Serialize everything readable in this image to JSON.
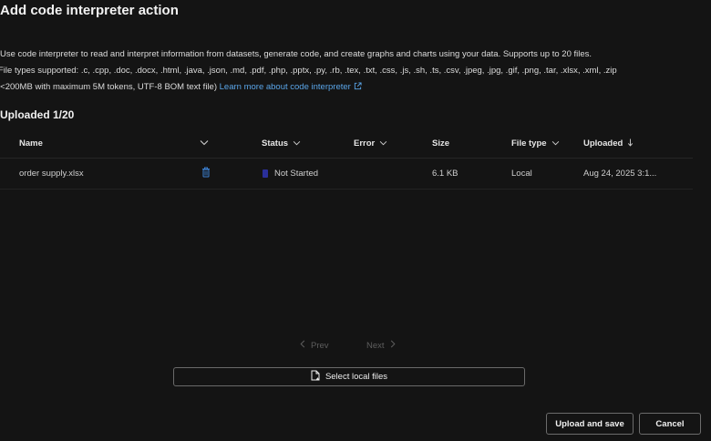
{
  "dialog": {
    "title": "Add code interpreter action",
    "description_line1": "Use code interpreter to read and interpret information from datasets, generate code, and create graphs and charts using your data. Supports up to 20 files.",
    "description_line2": "File types supported: .c, .cpp, .doc, .docx, .html, .java, .json, .md, .pdf, .php, .pptx, .py, .rb, .tex, .txt, .css, .js, .sh, .ts, .csv, .jpeg, .jpg, .gif, .png, .tar, .xlsx, .xml, .zip",
    "description_line3": "(<200MB with maximum 5M tokens, UTF-8 BOM text file)",
    "learn_more_link": "Learn more about code interpreter",
    "uploaded_label": "Uploaded 1/20"
  },
  "table": {
    "columns": {
      "name": "Name",
      "status": "Status",
      "error": "Error",
      "size": "Size",
      "file_type": "File type",
      "uploaded": "Uploaded"
    },
    "rows": [
      {
        "name": "order supply.xlsx",
        "status": "Not Started",
        "error": "",
        "size": "6.1 KB",
        "file_type": "Local",
        "uploaded": "Aug 24, 2025 3:1..."
      }
    ]
  },
  "pagination": {
    "prev_label": "Prev",
    "next_label": "Next"
  },
  "actions": {
    "select_files_label": "Select local files",
    "upload_save_label": "Upload and save",
    "cancel_label": "Cancel"
  },
  "colors": {
    "background": "#141414",
    "link": "#5aa5e8",
    "delete_icon": "#3b7fd0",
    "status_indicator": "#2a2f9a"
  }
}
